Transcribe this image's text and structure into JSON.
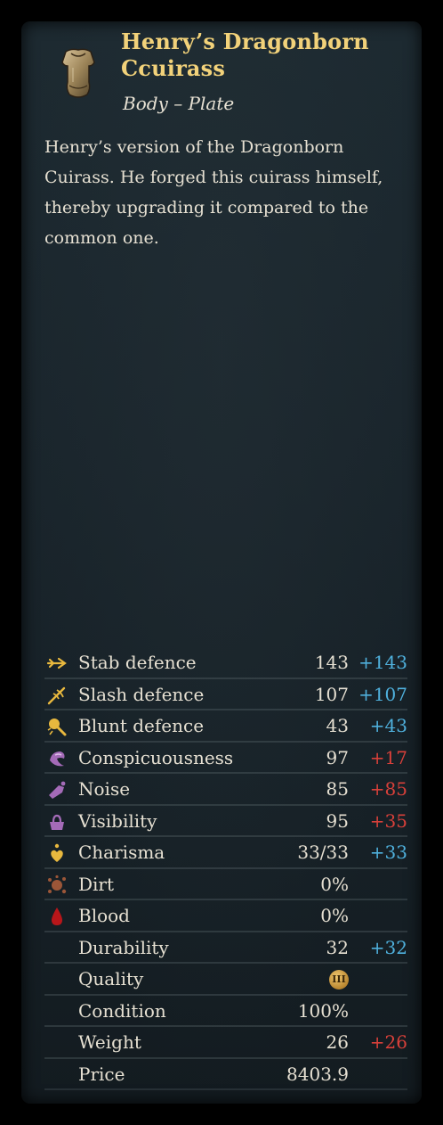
{
  "item": {
    "title": "Henry’s Dragonborn Ccuirass",
    "subtitle": "Body – Plate",
    "description": "Henry’s version of the Dragonborn Cuirass. He forged this cuirass himself, thereby upgrading it compared to the common one.",
    "icon": "cuirass-icon"
  },
  "colors": {
    "title": "#f2d27a",
    "positive_blue": "#4fb0dc",
    "negative_red": "#d8403a",
    "text": "#e6e0d2"
  },
  "stats": [
    {
      "label": "Stab defence",
      "value": "143",
      "delta": "+143",
      "delta_color": "blue",
      "icon": "stab-icon"
    },
    {
      "label": "Slash defence",
      "value": "107",
      "delta": "+107",
      "delta_color": "blue",
      "icon": "slash-icon"
    },
    {
      "label": "Blunt defence",
      "value": "43",
      "delta": "+43",
      "delta_color": "blue",
      "icon": "blunt-icon"
    },
    {
      "label": "Conspicuousness",
      "value": "97",
      "delta": "+17",
      "delta_color": "red",
      "icon": "conspicuousness-icon"
    },
    {
      "label": "Noise",
      "value": "85",
      "delta": "+85",
      "delta_color": "red",
      "icon": "noise-icon"
    },
    {
      "label": "Visibility",
      "value": "95",
      "delta": "+35",
      "delta_color": "red",
      "icon": "visibility-icon"
    },
    {
      "label": "Charisma",
      "value": "33/33",
      "delta": "+33",
      "delta_color": "blue",
      "icon": "charisma-icon"
    },
    {
      "label": "Dirt",
      "value": "0%",
      "delta": "",
      "delta_color": "",
      "icon": "dirt-icon"
    },
    {
      "label": "Blood",
      "value": "0%",
      "delta": "",
      "delta_color": "",
      "icon": "blood-icon"
    },
    {
      "label": "Durability",
      "value": "32",
      "delta": "+32",
      "delta_color": "blue",
      "icon": ""
    },
    {
      "label": "Quality",
      "value": "",
      "delta": "",
      "delta_color": "",
      "icon": "",
      "quality_badge": "III"
    },
    {
      "label": "Condition",
      "value": "100%",
      "delta": "",
      "delta_color": "",
      "icon": ""
    },
    {
      "label": "Weight",
      "value": "26",
      "delta": "+26",
      "delta_color": "red",
      "icon": ""
    },
    {
      "label": "Price",
      "value": "8403.9",
      "delta": "",
      "delta_color": "",
      "icon": ""
    }
  ]
}
